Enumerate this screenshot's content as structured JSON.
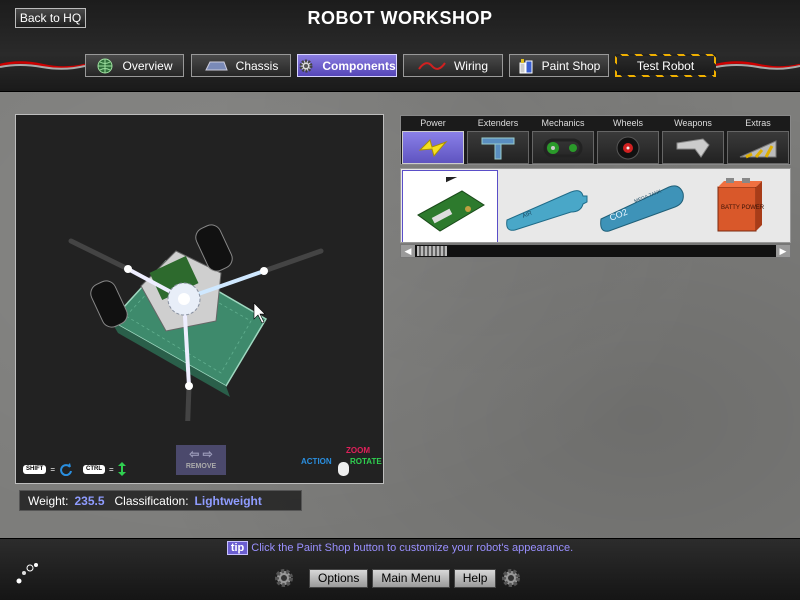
{
  "header": {
    "back_label": "Back to HQ",
    "title": "ROBOT WORKSHOP"
  },
  "tabs": [
    {
      "label": "Overview",
      "icon": "globe-icon",
      "active": false
    },
    {
      "label": "Chassis",
      "icon": "chassis-icon",
      "active": false
    },
    {
      "label": "Components",
      "icon": "gear-icon",
      "active": true
    },
    {
      "label": "Wiring",
      "icon": "wire-icon",
      "active": false
    },
    {
      "label": "Paint Shop",
      "icon": "paint-can-icon",
      "active": false
    },
    {
      "label": "Test Robot",
      "icon": "hazard-stripe",
      "active": false
    }
  ],
  "viewport": {
    "shift_key": "SHIFT",
    "ctrl_key": "CTRL",
    "remove_label": "REMOVE",
    "zoom_label": "ZOOM",
    "action_label": "ACTION",
    "rotate_label": "ROTATE"
  },
  "stats": {
    "weight_label": "Weight:",
    "weight_value": "235.5",
    "class_label": "Classification:",
    "class_value": "Lightweight"
  },
  "categories": [
    {
      "label": "Power",
      "icon": "lightning-icon",
      "active": true
    },
    {
      "label": "Extenders",
      "icon": "extender-icon",
      "active": false
    },
    {
      "label": "Mechanics",
      "icon": "chain-icon",
      "active": false
    },
    {
      "label": "Wheels",
      "icon": "wheel-icon",
      "active": false
    },
    {
      "label": "Weapons",
      "icon": "blade-icon",
      "active": false
    },
    {
      "label": "Extras",
      "icon": "wedge-icon",
      "active": false
    }
  ],
  "parts": [
    {
      "name": "circuit-board",
      "selected": true
    },
    {
      "name": "blue-air-tank",
      "selected": false
    },
    {
      "name": "co2-tank",
      "selected": false
    },
    {
      "name": "battery-box",
      "selected": false
    }
  ],
  "part_texts": {
    "co2": "CO2",
    "tank": "MEGA TANK",
    "battery": "BATTY POWER"
  },
  "tip": {
    "badge": "tip",
    "text": "Click the Paint Shop button to customize your robot's appearance."
  },
  "bottom_menu": {
    "options": "Options",
    "main_menu": "Main Menu",
    "help": "Help"
  },
  "colors": {
    "accent": "#6b5ed0",
    "value_text": "#8f9cff"
  }
}
